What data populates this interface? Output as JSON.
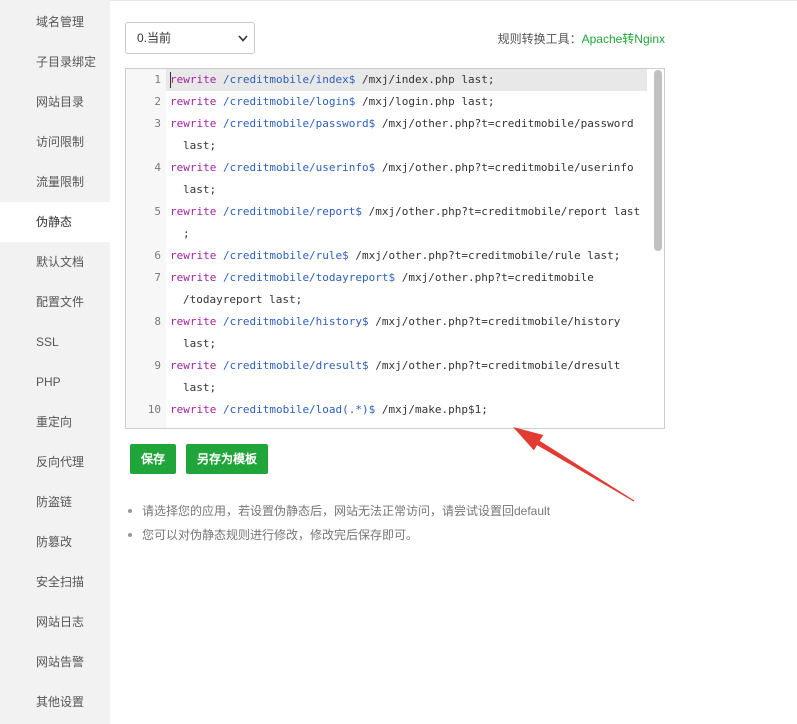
{
  "sidebar": {
    "items": [
      "域名管理",
      "子目录绑定",
      "网站目录",
      "访问限制",
      "流量限制",
      "伪静态",
      "默认文档",
      "配置文件",
      "SSL",
      "PHP",
      "重定向",
      "反向代理",
      "防盗链",
      "防篡改",
      "安全扫描",
      "网站日志",
      "网站告警",
      "其他设置"
    ]
  },
  "rule_select": {
    "value": "0.当前"
  },
  "converter": {
    "label": "规则转换工具：",
    "link": "Apache转Nginx"
  },
  "editor": {
    "lines": [
      {
        "num": "1",
        "keyword": "rewrite",
        "pattern": "/creditmobile/index$",
        "target": "/mxj/index.php last;"
      },
      {
        "num": "2",
        "keyword": "rewrite",
        "pattern": "/creditmobile/login$",
        "target": "/mxj/login.php last;"
      },
      {
        "num": "3",
        "keyword": "rewrite",
        "pattern": "/creditmobile/password$",
        "target": "/mxj/other.php?t=creditmobile/password",
        "wrap": "last;"
      },
      {
        "num": "4",
        "keyword": "rewrite",
        "pattern": "/creditmobile/userinfo$",
        "target": "/mxj/other.php?t=creditmobile/userinfo",
        "wrap": "last;"
      },
      {
        "num": "5",
        "keyword": "rewrite",
        "pattern": "/creditmobile/report$",
        "target": "/mxj/other.php?t=creditmobile/report last",
        "wrap": ";"
      },
      {
        "num": "6",
        "keyword": "rewrite",
        "pattern": "/creditmobile/rule$",
        "target": "/mxj/other.php?t=creditmobile/rule last;"
      },
      {
        "num": "7",
        "keyword": "rewrite",
        "pattern": "/creditmobile/todayreport$",
        "target": "/mxj/other.php?t=creditmobile",
        "wrap": "/todayreport last;"
      },
      {
        "num": "8",
        "keyword": "rewrite",
        "pattern": "/creditmobile/history$",
        "target": "/mxj/other.php?t=creditmobile/history",
        "wrap": "last;"
      },
      {
        "num": "9",
        "keyword": "rewrite",
        "pattern": "/creditmobile/dresult$",
        "target": "/mxj/other.php?t=creditmobile/dresult",
        "wrap": "last;"
      },
      {
        "num": "10",
        "keyword": "rewrite",
        "pattern": "/creditmobile/load(.*)$",
        "target": "/mxj/make.php$1;"
      }
    ]
  },
  "buttons": {
    "save": "保存",
    "save_as_template": "另存为模板"
  },
  "tips": [
    "请选择您的应用，若设置伪静态后，网站无法正常访问，请尝试设置回default",
    "您可以对伪静态规则进行修改，修改完后保存即可。"
  ],
  "icons": {
    "select_arrow": "chevron-down-icon",
    "annotation": "red-arrow-icon"
  },
  "colors": {
    "accent": "#20a53a",
    "keyword": "#a31fa3",
    "pattern": "#2b5fbd",
    "annotation": "#e23b33",
    "sidebar_bg": "#f2f2f2"
  }
}
